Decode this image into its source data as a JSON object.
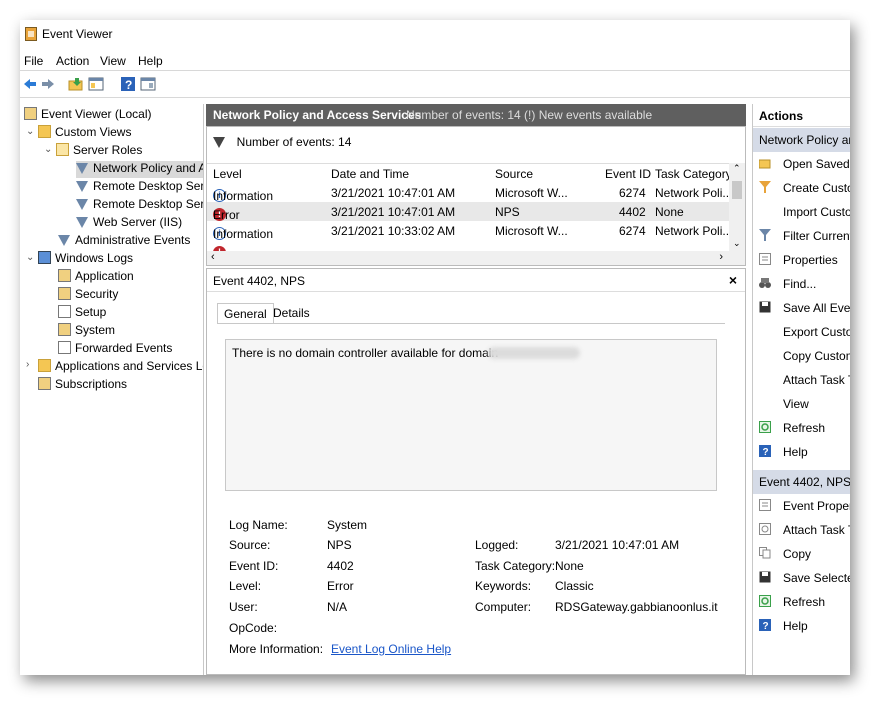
{
  "window": {
    "title": "Event Viewer"
  },
  "menu": [
    "File",
    "Action",
    "View",
    "Help"
  ],
  "tree": {
    "root": "Event Viewer (Local)",
    "custom_views": "Custom Views",
    "server_roles": "Server Roles",
    "network_policy": "Network Policy and A",
    "remote_desktop_1": "Remote Desktop Serv",
    "remote_desktop_2": "Remote Desktop Serv",
    "web_server": "Web Server (IIS)",
    "administrative_events": "Administrative Events",
    "windows_logs": "Windows Logs",
    "application": "Application",
    "security": "Security",
    "setup": "Setup",
    "system": "System",
    "forwarded_events": "Forwarded Events",
    "apps_services": "Applications and Services Log",
    "subscriptions": "Subscriptions"
  },
  "list_header": {
    "title": "Network Policy and Access Services",
    "subtitle": "Number of events: 14 (!) New events available"
  },
  "filter_bar": {
    "text": "Number of events: 14"
  },
  "columns": {
    "level": "Level",
    "date": "Date and Time",
    "source": "Source",
    "event_id": "Event ID",
    "task": "Task Category"
  },
  "events": [
    {
      "level": "Information",
      "date": "3/21/2021 10:47:01 AM",
      "source": "Microsoft W...",
      "event_id": "6274",
      "task": "Network Poli..."
    },
    {
      "level": "Error",
      "date": "3/21/2021 10:47:01 AM",
      "source": "NPS",
      "event_id": "4402",
      "task": "None"
    },
    {
      "level": "Information",
      "date": "3/21/2021 10:33:02 AM",
      "source": "Microsoft W...",
      "event_id": "6274",
      "task": "Network Poli..."
    }
  ],
  "detail": {
    "title": "Event 4402, NPS",
    "close": "×",
    "tabs": [
      "General",
      "Details"
    ],
    "description": "There is no domain controller available for domain",
    "labels": {
      "log_name": "Log Name:",
      "source": "Source:",
      "event_id": "Event ID:",
      "level": "Level:",
      "user": "User:",
      "opcode": "OpCode:",
      "more_info": "More Information:",
      "logged": "Logged:",
      "task_category": "Task Category:",
      "keywords": "Keywords:",
      "computer": "Computer:"
    },
    "values": {
      "log_name": "System",
      "source": "NPS",
      "event_id": "4402",
      "level": "Error",
      "user": "N/A",
      "logged": "3/21/2021 10:47:01 AM",
      "task_category": "None",
      "keywords": "Classic",
      "computer": "RDSGateway.gabbianoonlus.it",
      "more_info_link": "Event Log Online Help"
    }
  },
  "actions": {
    "header": "Actions",
    "section1": "Network Policy and",
    "items1": [
      "Open Saved L",
      "Create Custon",
      "Import Custor",
      "Filter Current",
      "Properties",
      "Find...",
      "Save All Event",
      "Export Custon",
      "Copy Custom",
      "Attach Task To",
      "View",
      "Refresh",
      "Help"
    ],
    "section2": "Event 4402, NPS",
    "items2": [
      "Event Properti",
      "Attach Task To",
      "Copy",
      "Save Selected",
      "Refresh",
      "Help"
    ]
  }
}
